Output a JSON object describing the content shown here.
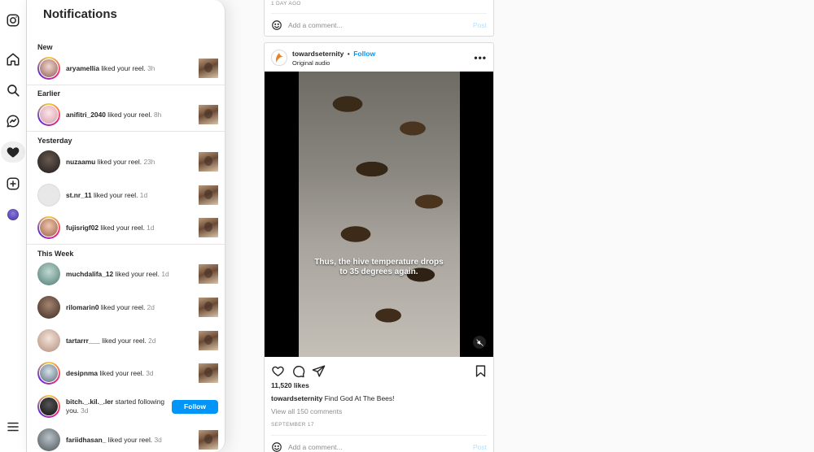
{
  "panel": {
    "title": "Notifications",
    "sections": {
      "new": "New",
      "earlier": "Earlier",
      "yesterday": "Yesterday",
      "this_week": "This Week"
    },
    "notifications": [
      {
        "user": "aryamellia",
        "action": "liked your reel.",
        "time": "3h"
      },
      {
        "user": "anifitri_2040",
        "action": "liked your reel.",
        "time": "8h"
      },
      {
        "user": "nuzaamu",
        "action": "liked your reel.",
        "time": "23h"
      },
      {
        "user": "st.nr_11",
        "action": "liked your reel.",
        "time": "1d"
      },
      {
        "user": "fujisrigf02",
        "action": "liked your reel.",
        "time": "1d"
      },
      {
        "user": "muchdalifa_12",
        "action": "liked your reel.",
        "time": "1d"
      },
      {
        "user": "rilomarin0",
        "action": "liked your reel.",
        "time": "2d"
      },
      {
        "user": "tartarrr___",
        "action": "liked your reel.",
        "time": "2d"
      },
      {
        "user": "desipnma",
        "action": "liked your reel.",
        "time": "3d"
      },
      {
        "user": "bitch._.kil._.ler",
        "action": "started following you.",
        "time": "3d",
        "button": "Follow"
      },
      {
        "user": "fariidhasan_",
        "action": "liked your reel.",
        "time": "3d"
      }
    ]
  },
  "feed": {
    "top_post": {
      "date": "1 DAY AGO",
      "comment_placeholder": "Add a comment...",
      "post_label": "Post"
    },
    "post": {
      "username": "towardseternity",
      "separator": "•",
      "follow_label": "Follow",
      "audio": "Original audio",
      "more": "•••",
      "video_caption_line1": "Thus, the hive temperature drops",
      "video_caption_line2": "to 35 degrees again.",
      "likes": "11,520 likes",
      "caption_user": "towardseternity",
      "caption_text": "Find God At The Bees!",
      "view_comments": "View all 150 comments",
      "date": "SEPTEMBER 17",
      "comment_placeholder": "Add a comment...",
      "post_label": "Post"
    }
  },
  "colors": {
    "accent_blue": "#0095f6",
    "text": "#262626",
    "muted": "#8e8e8e",
    "border": "#dbdbdb"
  }
}
